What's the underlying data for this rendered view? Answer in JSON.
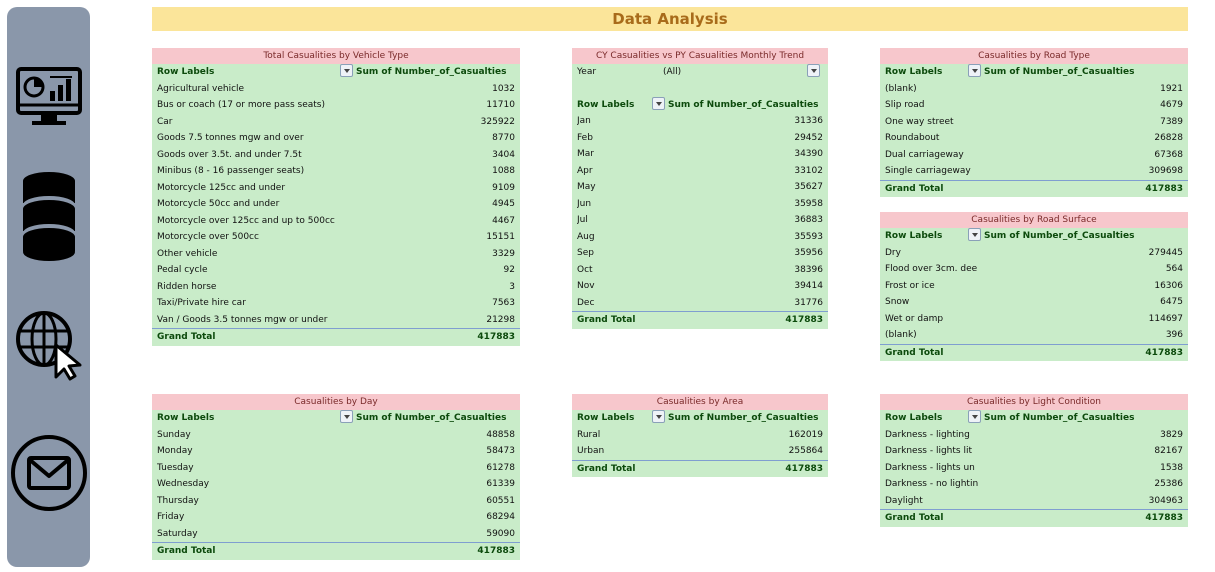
{
  "page": {
    "title": "Data Analysis"
  },
  "sidebar": {
    "icons": [
      "dashboard-monitor-icon",
      "database-icon",
      "globe-cursor-icon",
      "mail-icon"
    ]
  },
  "pivots": {
    "vehicle": {
      "title": "Total Casualities by Vehicle Type",
      "row_labels": "Row Labels",
      "sum_header": "Sum of Number_of_Casualties",
      "rows": [
        {
          "label": "Agricultural vehicle",
          "value": "1032"
        },
        {
          "label": "Bus or coach (17 or more pass seats)",
          "value": "11710"
        },
        {
          "label": "Car",
          "value": "325922"
        },
        {
          "label": "Goods 7.5 tonnes mgw and over",
          "value": "8770"
        },
        {
          "label": "Goods over 3.5t. and under 7.5t",
          "value": "3404"
        },
        {
          "label": "Minibus (8 - 16 passenger seats)",
          "value": "1088"
        },
        {
          "label": "Motorcycle 125cc and under",
          "value": "9109"
        },
        {
          "label": "Motorcycle 50cc and under",
          "value": "4945"
        },
        {
          "label": "Motorcycle over 125cc and up to 500cc",
          "value": "4467"
        },
        {
          "label": "Motorcycle over 500cc",
          "value": "15151"
        },
        {
          "label": "Other vehicle",
          "value": "3329"
        },
        {
          "label": "Pedal cycle",
          "value": "92"
        },
        {
          "label": "Ridden horse",
          "value": "3"
        },
        {
          "label": "Taxi/Private hire car",
          "value": "7563"
        },
        {
          "label": "Van / Goods 3.5 tonnes mgw or under",
          "value": "21298"
        }
      ],
      "total_label": "Grand Total",
      "total_value": "417883"
    },
    "monthly": {
      "title": "CY Casualities vs PY Casualities Monthly Trend",
      "filter_label": "Year",
      "filter_value": "(All)",
      "row_labels": "Row Labels",
      "sum_header": "Sum of Number_of_Casualties",
      "rows": [
        {
          "label": "Jan",
          "value": "31336"
        },
        {
          "label": "Feb",
          "value": "29452"
        },
        {
          "label": "Mar",
          "value": "34390"
        },
        {
          "label": "Apr",
          "value": "33102"
        },
        {
          "label": "May",
          "value": "35627"
        },
        {
          "label": "Jun",
          "value": "35958"
        },
        {
          "label": "Jul",
          "value": "36883"
        },
        {
          "label": "Aug",
          "value": "35593"
        },
        {
          "label": "Sep",
          "value": "35956"
        },
        {
          "label": "Oct",
          "value": "38396"
        },
        {
          "label": "Nov",
          "value": "39414"
        },
        {
          "label": "Dec",
          "value": "31776"
        }
      ],
      "total_label": "Grand Total",
      "total_value": "417883"
    },
    "road_type": {
      "title": "Casualities by Road Type",
      "row_labels": "Row Labels",
      "sum_header": "Sum of Number_of_Casualties",
      "rows": [
        {
          "label": "(blank)",
          "value": "1921"
        },
        {
          "label": "Slip road",
          "value": "4679"
        },
        {
          "label": "One way street",
          "value": "7389"
        },
        {
          "label": "Roundabout",
          "value": "26828"
        },
        {
          "label": "Dual carriageway",
          "value": "67368"
        },
        {
          "label": "Single carriageway",
          "value": "309698"
        }
      ],
      "total_label": "Grand Total",
      "total_value": "417883"
    },
    "road_surface": {
      "title": "Casualities by Road Surface",
      "row_labels": "Row Labels",
      "sum_header": "Sum of Number_of_Casualties",
      "rows": [
        {
          "label": "Dry",
          "value": "279445"
        },
        {
          "label": "Flood over 3cm. dee",
          "value": "564"
        },
        {
          "label": "Frost or ice",
          "value": "16306"
        },
        {
          "label": "Snow",
          "value": "6475"
        },
        {
          "label": "Wet or damp",
          "value": "114697"
        },
        {
          "label": "(blank)",
          "value": "396"
        }
      ],
      "total_label": "Grand Total",
      "total_value": "417883"
    },
    "day": {
      "title": "Casualities by Day",
      "row_labels": "Row Labels",
      "sum_header": "Sum of Number_of_Casualties",
      "rows": [
        {
          "label": "Sunday",
          "value": "48858"
        },
        {
          "label": "Monday",
          "value": "58473"
        },
        {
          "label": "Tuesday",
          "value": "61278"
        },
        {
          "label": "Wednesday",
          "value": "61339"
        },
        {
          "label": "Thursday",
          "value": "60551"
        },
        {
          "label": "Friday",
          "value": "68294"
        },
        {
          "label": "Saturday",
          "value": "59090"
        }
      ],
      "total_label": "Grand Total",
      "total_value": "417883"
    },
    "area": {
      "title": "Casualities by Area",
      "row_labels": "Row Labels",
      "sum_header": "Sum of Number_of_Casualties",
      "rows": [
        {
          "label": "Rural",
          "value": "162019"
        },
        {
          "label": "Urban",
          "value": "255864"
        }
      ],
      "total_label": "Grand Total",
      "total_value": "417883"
    },
    "light": {
      "title": "Casualities by Light Condition",
      "row_labels": "Row Labels",
      "sum_header": "Sum of Number_of_Casualties",
      "rows": [
        {
          "label": "Darkness - lighting",
          "value": "3829"
        },
        {
          "label": "Darkness - lights lit",
          "value": "82167"
        },
        {
          "label": "Darkness - lights un",
          "value": "1538"
        },
        {
          "label": "Darkness - no lightin",
          "value": "25386"
        },
        {
          "label": "Daylight",
          "value": "304963"
        }
      ],
      "total_label": "Grand Total",
      "total_value": "417883"
    }
  }
}
